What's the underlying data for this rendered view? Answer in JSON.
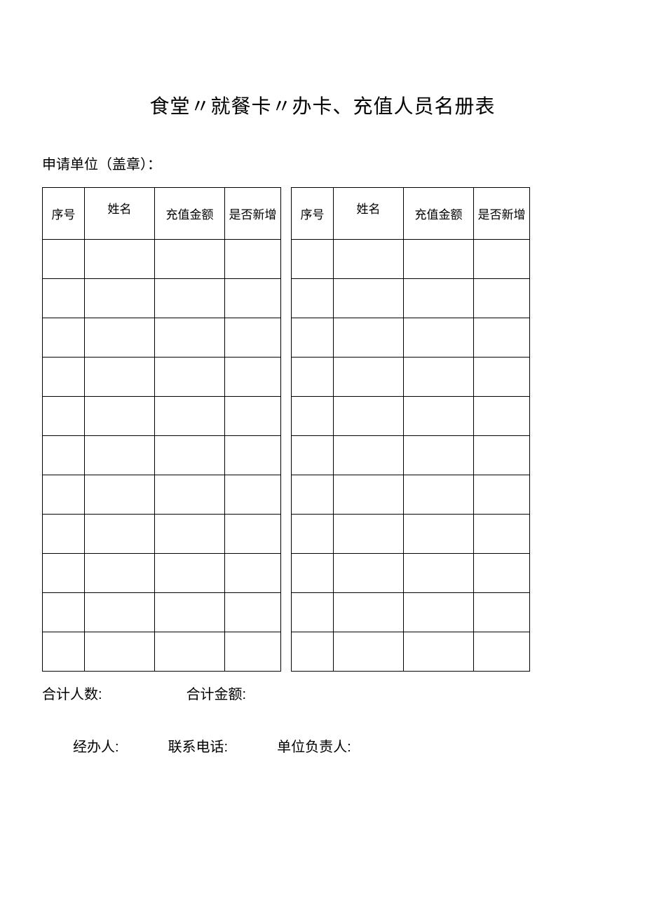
{
  "title": "食堂〃就餐卡〃办卡、充值人员名册表",
  "applicant_label": "申请单位（盖章）：",
  "headers": {
    "seq": "序号",
    "name": "姓名",
    "amount": "充值金额",
    "is_new": "是否新增"
  },
  "left_rows": [
    {
      "seq": "",
      "name": "",
      "amount": "",
      "is_new": ""
    },
    {
      "seq": "",
      "name": "",
      "amount": "",
      "is_new": ""
    },
    {
      "seq": "",
      "name": "",
      "amount": "",
      "is_new": ""
    },
    {
      "seq": "",
      "name": "",
      "amount": "",
      "is_new": ""
    },
    {
      "seq": "",
      "name": "",
      "amount": "",
      "is_new": ""
    },
    {
      "seq": "",
      "name": "",
      "amount": "",
      "is_new": ""
    },
    {
      "seq": "",
      "name": "",
      "amount": "",
      "is_new": ""
    },
    {
      "seq": "",
      "name": "",
      "amount": "",
      "is_new": ""
    },
    {
      "seq": "",
      "name": "",
      "amount": "",
      "is_new": ""
    },
    {
      "seq": "",
      "name": "",
      "amount": "",
      "is_new": ""
    },
    {
      "seq": "",
      "name": "",
      "amount": "",
      "is_new": ""
    }
  ],
  "right_rows": [
    {
      "seq": "",
      "name": "",
      "amount": "",
      "is_new": ""
    },
    {
      "seq": "",
      "name": "",
      "amount": "",
      "is_new": ""
    },
    {
      "seq": "",
      "name": "",
      "amount": "",
      "is_new": ""
    },
    {
      "seq": "",
      "name": "",
      "amount": "",
      "is_new": ""
    },
    {
      "seq": "",
      "name": "",
      "amount": "",
      "is_new": ""
    },
    {
      "seq": "",
      "name": "",
      "amount": "",
      "is_new": ""
    },
    {
      "seq": "",
      "name": "",
      "amount": "",
      "is_new": ""
    },
    {
      "seq": "",
      "name": "",
      "amount": "",
      "is_new": ""
    },
    {
      "seq": "",
      "name": "",
      "amount": "",
      "is_new": ""
    },
    {
      "seq": "",
      "name": "",
      "amount": "",
      "is_new": ""
    },
    {
      "seq": "",
      "name": "",
      "amount": "",
      "is_new": ""
    }
  ],
  "totals": {
    "count_label": "合计人数:",
    "amount_label": "合计金额:"
  },
  "footer": {
    "handler_label": "经办人:",
    "phone_label": "联系电话:",
    "manager_label": "单位负责人:"
  }
}
